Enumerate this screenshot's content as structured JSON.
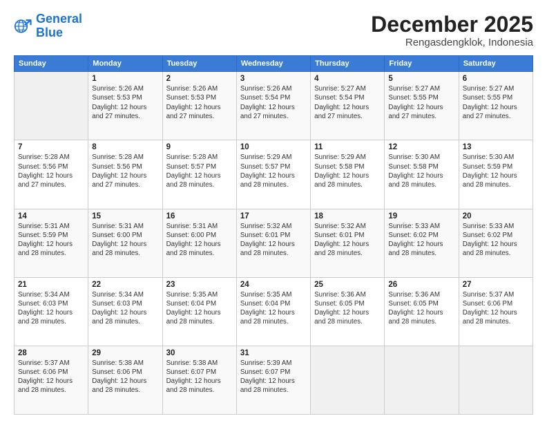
{
  "logo": {
    "line1": "General",
    "line2": "Blue"
  },
  "title": "December 2025",
  "subtitle": "Rengasdengklok, Indonesia",
  "days": [
    "Sunday",
    "Monday",
    "Tuesday",
    "Wednesday",
    "Thursday",
    "Friday",
    "Saturday"
  ],
  "weeks": [
    [
      {
        "date": "",
        "info": ""
      },
      {
        "date": "1",
        "info": "Sunrise: 5:26 AM\nSunset: 5:53 PM\nDaylight: 12 hours\nand 27 minutes."
      },
      {
        "date": "2",
        "info": "Sunrise: 5:26 AM\nSunset: 5:53 PM\nDaylight: 12 hours\nand 27 minutes."
      },
      {
        "date": "3",
        "info": "Sunrise: 5:26 AM\nSunset: 5:54 PM\nDaylight: 12 hours\nand 27 minutes."
      },
      {
        "date": "4",
        "info": "Sunrise: 5:27 AM\nSunset: 5:54 PM\nDaylight: 12 hours\nand 27 minutes."
      },
      {
        "date": "5",
        "info": "Sunrise: 5:27 AM\nSunset: 5:55 PM\nDaylight: 12 hours\nand 27 minutes."
      },
      {
        "date": "6",
        "info": "Sunrise: 5:27 AM\nSunset: 5:55 PM\nDaylight: 12 hours\nand 27 minutes."
      }
    ],
    [
      {
        "date": "7",
        "info": "Sunrise: 5:28 AM\nSunset: 5:56 PM\nDaylight: 12 hours\nand 27 minutes."
      },
      {
        "date": "8",
        "info": "Sunrise: 5:28 AM\nSunset: 5:56 PM\nDaylight: 12 hours\nand 27 minutes."
      },
      {
        "date": "9",
        "info": "Sunrise: 5:28 AM\nSunset: 5:57 PM\nDaylight: 12 hours\nand 28 minutes."
      },
      {
        "date": "10",
        "info": "Sunrise: 5:29 AM\nSunset: 5:57 PM\nDaylight: 12 hours\nand 28 minutes."
      },
      {
        "date": "11",
        "info": "Sunrise: 5:29 AM\nSunset: 5:58 PM\nDaylight: 12 hours\nand 28 minutes."
      },
      {
        "date": "12",
        "info": "Sunrise: 5:30 AM\nSunset: 5:58 PM\nDaylight: 12 hours\nand 28 minutes."
      },
      {
        "date": "13",
        "info": "Sunrise: 5:30 AM\nSunset: 5:59 PM\nDaylight: 12 hours\nand 28 minutes."
      }
    ],
    [
      {
        "date": "14",
        "info": "Sunrise: 5:31 AM\nSunset: 5:59 PM\nDaylight: 12 hours\nand 28 minutes."
      },
      {
        "date": "15",
        "info": "Sunrise: 5:31 AM\nSunset: 6:00 PM\nDaylight: 12 hours\nand 28 minutes."
      },
      {
        "date": "16",
        "info": "Sunrise: 5:31 AM\nSunset: 6:00 PM\nDaylight: 12 hours\nand 28 minutes."
      },
      {
        "date": "17",
        "info": "Sunrise: 5:32 AM\nSunset: 6:01 PM\nDaylight: 12 hours\nand 28 minutes."
      },
      {
        "date": "18",
        "info": "Sunrise: 5:32 AM\nSunset: 6:01 PM\nDaylight: 12 hours\nand 28 minutes."
      },
      {
        "date": "19",
        "info": "Sunrise: 5:33 AM\nSunset: 6:02 PM\nDaylight: 12 hours\nand 28 minutes."
      },
      {
        "date": "20",
        "info": "Sunrise: 5:33 AM\nSunset: 6:02 PM\nDaylight: 12 hours\nand 28 minutes."
      }
    ],
    [
      {
        "date": "21",
        "info": "Sunrise: 5:34 AM\nSunset: 6:03 PM\nDaylight: 12 hours\nand 28 minutes."
      },
      {
        "date": "22",
        "info": "Sunrise: 5:34 AM\nSunset: 6:03 PM\nDaylight: 12 hours\nand 28 minutes."
      },
      {
        "date": "23",
        "info": "Sunrise: 5:35 AM\nSunset: 6:04 PM\nDaylight: 12 hours\nand 28 minutes."
      },
      {
        "date": "24",
        "info": "Sunrise: 5:35 AM\nSunset: 6:04 PM\nDaylight: 12 hours\nand 28 minutes."
      },
      {
        "date": "25",
        "info": "Sunrise: 5:36 AM\nSunset: 6:05 PM\nDaylight: 12 hours\nand 28 minutes."
      },
      {
        "date": "26",
        "info": "Sunrise: 5:36 AM\nSunset: 6:05 PM\nDaylight: 12 hours\nand 28 minutes."
      },
      {
        "date": "27",
        "info": "Sunrise: 5:37 AM\nSunset: 6:06 PM\nDaylight: 12 hours\nand 28 minutes."
      }
    ],
    [
      {
        "date": "28",
        "info": "Sunrise: 5:37 AM\nSunset: 6:06 PM\nDaylight: 12 hours\nand 28 minutes."
      },
      {
        "date": "29",
        "info": "Sunrise: 5:38 AM\nSunset: 6:06 PM\nDaylight: 12 hours\nand 28 minutes."
      },
      {
        "date": "30",
        "info": "Sunrise: 5:38 AM\nSunset: 6:07 PM\nDaylight: 12 hours\nand 28 minutes."
      },
      {
        "date": "31",
        "info": "Sunrise: 5:39 AM\nSunset: 6:07 PM\nDaylight: 12 hours\nand 28 minutes."
      },
      {
        "date": "",
        "info": ""
      },
      {
        "date": "",
        "info": ""
      },
      {
        "date": "",
        "info": ""
      }
    ]
  ]
}
